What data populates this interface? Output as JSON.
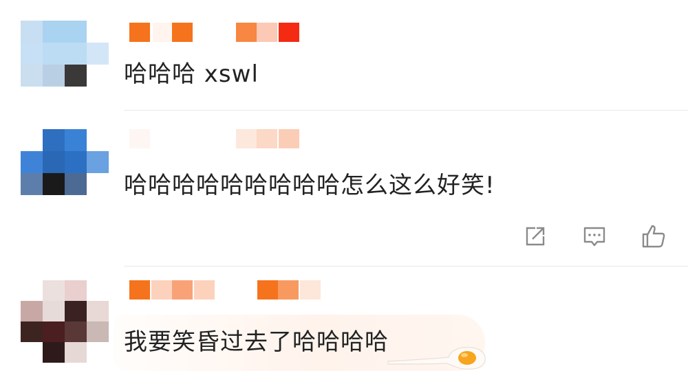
{
  "comments": [
    {
      "text": "哈哈哈 xswl"
    },
    {
      "text": "哈哈哈哈哈哈哈哈哈怎么这么好笑!"
    },
    {
      "text": "我要笑昏过去了哈哈哈哈"
    }
  ],
  "actions": [
    {
      "icon": "share-icon"
    },
    {
      "icon": "comment-icon"
    },
    {
      "icon": "thumbs-up-icon"
    }
  ],
  "colors": {
    "text": "#222222",
    "divider": "#e8e8e8",
    "icon": "#8a8a8a",
    "name_orange": "#f5731c",
    "name_red": "#f52a12",
    "egg_yolk": "#f7a51e"
  }
}
